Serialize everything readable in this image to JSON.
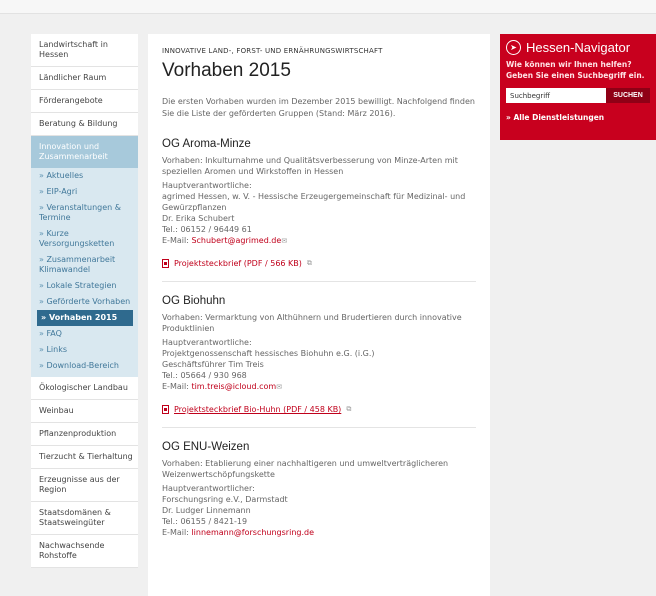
{
  "sidebar": {
    "items_top": [
      "Landwirtschaft in Hessen",
      "Ländlicher Raum",
      "Förderangebote",
      "Beratung & Bildung"
    ],
    "active_group": "Innovation und Zusammenarbeit",
    "sub_items": [
      "Aktuelles",
      "EIP-Agri",
      "Veranstaltungen & Termine",
      "Kurze Versorgungsketten",
      "Zusammenarbeit Klimawandel",
      "Lokale Strategien",
      "Geförderte Vorhaben"
    ],
    "current_item": "Vorhaben 2015",
    "sub_items_after": [
      "FAQ",
      "Links",
      "Download-Bereich"
    ],
    "items_bottom": [
      "Ökologischer Landbau",
      "Weinbau",
      "Pflanzenproduktion",
      "Tierzucht & Tierhaltung",
      "Erzeugnisse aus der Region",
      "Staatsdomänen & Staatsweingüter",
      "Nachwachsende Rohstoffe"
    ]
  },
  "main": {
    "kicker": "INNOVATIVE LAND-, FORST- UND ERNÄHRUNGSWIRTSCHAFT",
    "title": "Vorhaben 2015",
    "intro": "Die ersten Vorhaben wurden im Dezember 2015 bewilligt. Nachfolgend finden Sie die Liste der geförderten Gruppen (Stand: März 2016).",
    "groups": [
      {
        "title": "OG Aroma-Minze",
        "vorhaben": "Vorhaben: Inkulturnahme und Qualitätsverbesserung von Minze-Arten mit speziellen Aromen und Wirkstoffen in Hessen",
        "lines": [
          "Hauptverantwortliche:",
          "agrimed Hessen, w. V. - Hessische Erzeugergemeinschaft für Medizinal- und Gewürzpflanzen",
          "Dr. Erika Schubert",
          "Tel.: 06152 / 96449 61"
        ],
        "email_label": "E-Mail: ",
        "email": "Schubert@agrimed.de",
        "pdf": "Projektsteckbrief (PDF / 566 KB)"
      },
      {
        "title": "OG Biohuhn",
        "vorhaben": "Vorhaben: Vermarktung von Althühnern und Brudertieren durch innovative Produktlinien",
        "lines": [
          "Hauptverantwortliche:",
          "Projektgenossenschaft hessisches Biohuhn e.G. (i.G.)",
          "Geschäftsführer Tim Treis",
          "Tel.: 05664 / 930 968"
        ],
        "email_label": "E-Mail: ",
        "email": "tim.treis@icloud.com",
        "pdf": "Projektsteckbrief Bio-Huhn (PDF / 458 KB)"
      },
      {
        "title": "OG ENU-Weizen",
        "vorhaben": "Vorhaben: Etablierung einer nachhaltigeren und umweltverträglicheren Weizenwertschöpfungskette",
        "lines": [
          "Hauptverantwortlicher:",
          "Forschungsring e.V., Darmstadt",
          "Dr. Ludger Linnemann",
          "Tel.: 06155 / 8421-19"
        ],
        "email_label": "E-Mail: ",
        "email": "linnemann@forschungsring.de"
      }
    ]
  },
  "hessen_navigator": {
    "title": "Hessen-Navigator",
    "subtitle": "Wie können wir Ihnen helfen? Geben Sie einen Suchbegriff ein.",
    "search_value": "Suchbegriff",
    "search_button": "SUCHEN",
    "all_services": "» Alle Dienstleistungen",
    "accent": "#c8001e"
  }
}
